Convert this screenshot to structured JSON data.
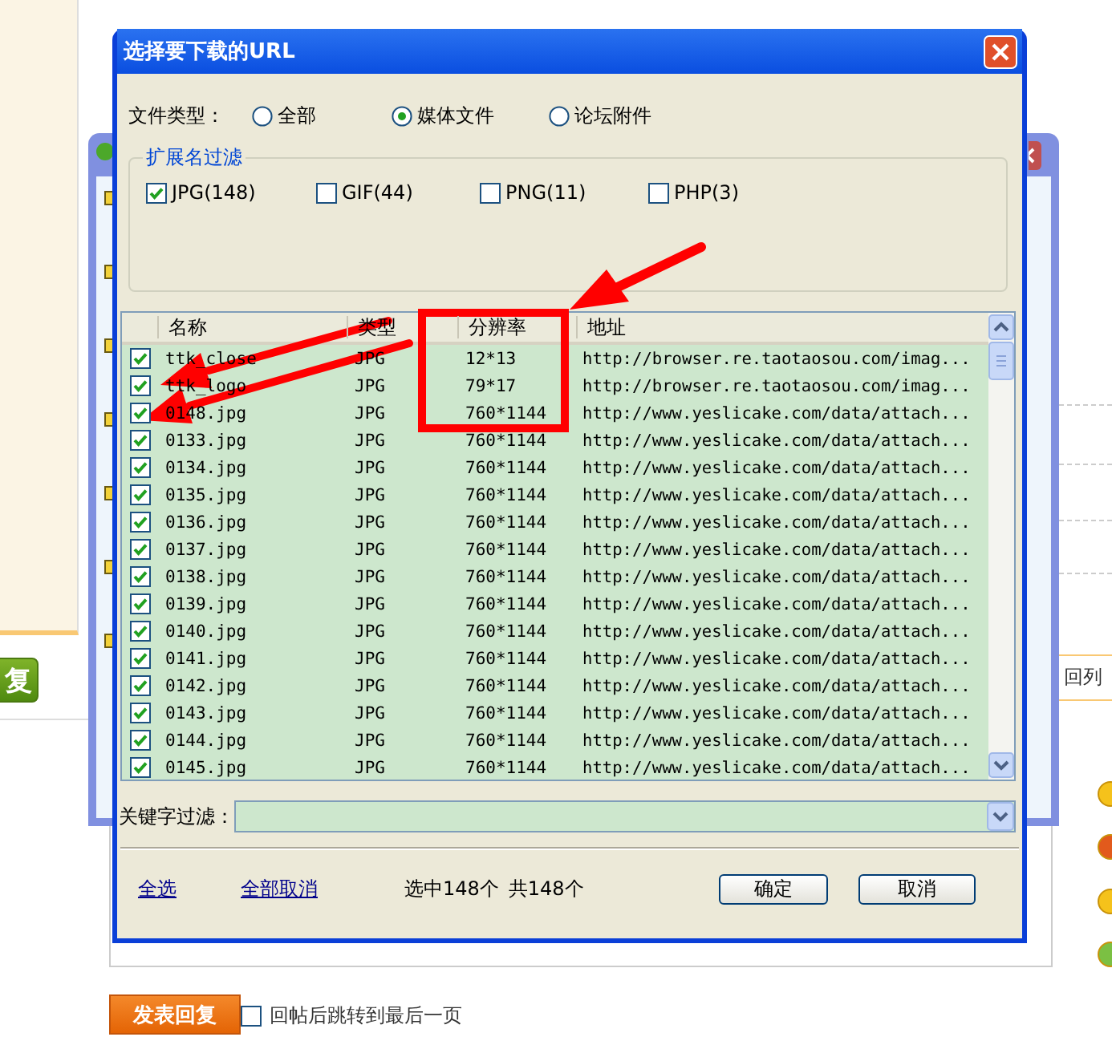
{
  "page": {
    "side_button": "复",
    "back_link": "回列",
    "reply_button": "发表回复",
    "jump_option": {
      "label": "回帖后跳转到最后一页",
      "checked": false
    }
  },
  "dialog": {
    "title": "选择要下载的URL",
    "file_type": {
      "label": "文件类型：",
      "options": [
        {
          "label": "全部",
          "selected": false
        },
        {
          "label": "媒体文件",
          "selected": true
        },
        {
          "label": "论坛附件",
          "selected": false
        }
      ]
    },
    "extension_filter": {
      "legend": "扩展名过滤",
      "items": [
        {
          "label": "JPG(148)",
          "checked": true
        },
        {
          "label": "GIF(44)",
          "checked": false
        },
        {
          "label": "PNG(11)",
          "checked": false
        },
        {
          "label": "PHP(3)",
          "checked": false
        }
      ]
    },
    "table": {
      "columns": [
        "名称",
        "类型",
        "分辨率",
        "地址"
      ],
      "rows": [
        {
          "checked": true,
          "name": "ttk_close",
          "type": "JPG",
          "resolution": "12*13",
          "url": "http://browser.re.taotaosou.com/imag..."
        },
        {
          "checked": true,
          "name": "ttk_logo",
          "type": "JPG",
          "resolution": "79*17",
          "url": "http://browser.re.taotaosou.com/imag..."
        },
        {
          "checked": true,
          "name": "0148.jpg",
          "type": "JPG",
          "resolution": "760*1144",
          "url": "http://www.yeslicake.com/data/attach..."
        },
        {
          "checked": true,
          "name": "0133.jpg",
          "type": "JPG",
          "resolution": "760*1144",
          "url": "http://www.yeslicake.com/data/attach..."
        },
        {
          "checked": true,
          "name": "0134.jpg",
          "type": "JPG",
          "resolution": "760*1144",
          "url": "http://www.yeslicake.com/data/attach..."
        },
        {
          "checked": true,
          "name": "0135.jpg",
          "type": "JPG",
          "resolution": "760*1144",
          "url": "http://www.yeslicake.com/data/attach..."
        },
        {
          "checked": true,
          "name": "0136.jpg",
          "type": "JPG",
          "resolution": "760*1144",
          "url": "http://www.yeslicake.com/data/attach..."
        },
        {
          "checked": true,
          "name": "0137.jpg",
          "type": "JPG",
          "resolution": "760*1144",
          "url": "http://www.yeslicake.com/data/attach..."
        },
        {
          "checked": true,
          "name": "0138.jpg",
          "type": "JPG",
          "resolution": "760*1144",
          "url": "http://www.yeslicake.com/data/attach..."
        },
        {
          "checked": true,
          "name": "0139.jpg",
          "type": "JPG",
          "resolution": "760*1144",
          "url": "http://www.yeslicake.com/data/attach..."
        },
        {
          "checked": true,
          "name": "0140.jpg",
          "type": "JPG",
          "resolution": "760*1144",
          "url": "http://www.yeslicake.com/data/attach..."
        },
        {
          "checked": true,
          "name": "0141.jpg",
          "type": "JPG",
          "resolution": "760*1144",
          "url": "http://www.yeslicake.com/data/attach..."
        },
        {
          "checked": true,
          "name": "0142.jpg",
          "type": "JPG",
          "resolution": "760*1144",
          "url": "http://www.yeslicake.com/data/attach..."
        },
        {
          "checked": true,
          "name": "0143.jpg",
          "type": "JPG",
          "resolution": "760*1144",
          "url": "http://www.yeslicake.com/data/attach..."
        },
        {
          "checked": true,
          "name": "0144.jpg",
          "type": "JPG",
          "resolution": "760*1144",
          "url": "http://www.yeslicake.com/data/attach..."
        },
        {
          "checked": true,
          "name": "0145.jpg",
          "type": "JPG",
          "resolution": "760*1144",
          "url": "http://www.yeslicake.com/data/attach..."
        }
      ]
    },
    "keyword_filter": {
      "label": "关键字过滤："
    },
    "footer": {
      "links": [
        "全选",
        "全部取消"
      ],
      "selected_count": "选中148个",
      "total_count": "共148个",
      "buttons": [
        "确定",
        "取消"
      ]
    }
  }
}
